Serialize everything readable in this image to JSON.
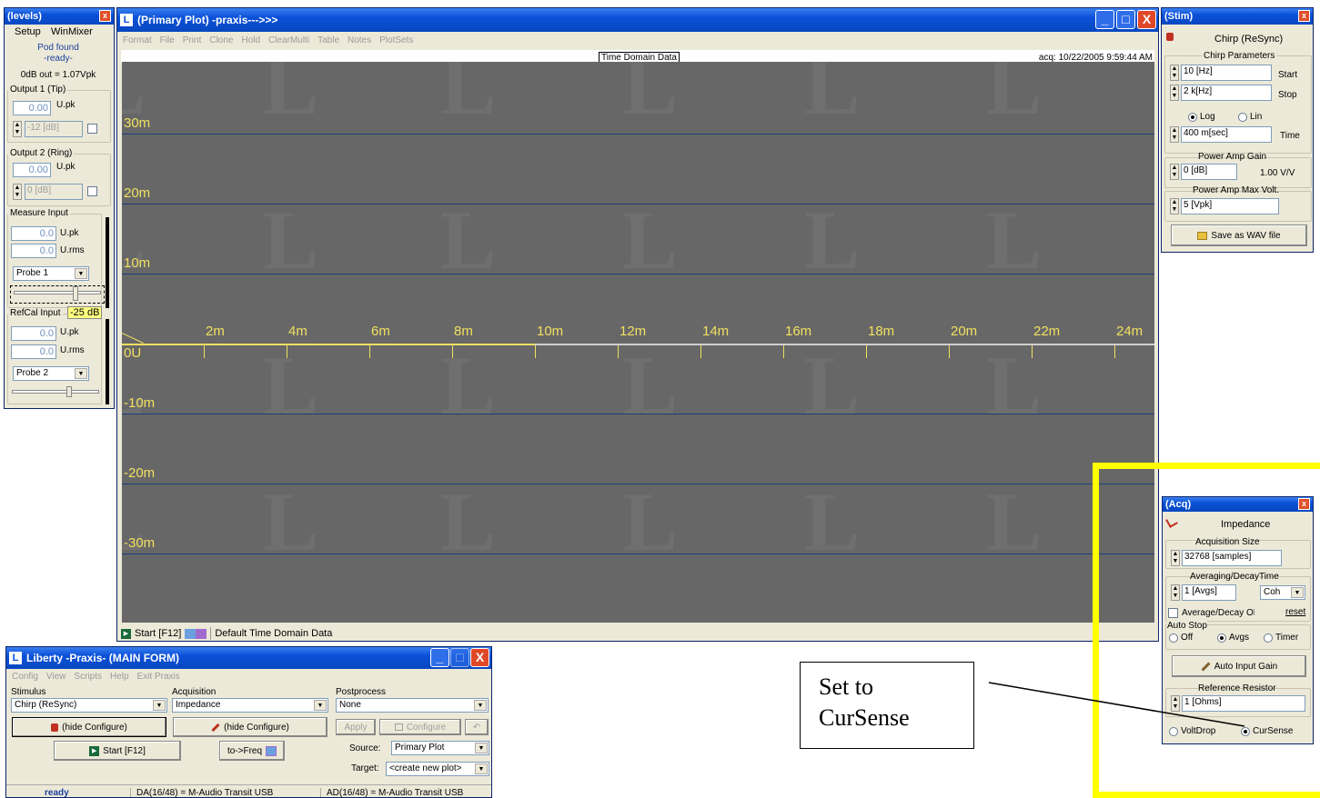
{
  "levels": {
    "title": "(levels)",
    "menu": [
      "Setup",
      "WinMixer"
    ],
    "status1": "Pod found",
    "status2": "-ready-",
    "odb": "0dB out = 1.07Vpk",
    "output1": {
      "label": "Output 1 (Tip)",
      "value": "0.00",
      "unit": "U.pk",
      "gain": "-12 [dB]"
    },
    "output2": {
      "label": "Output 2 (Ring)",
      "value": "0.00",
      "unit": "U.pk",
      "gain": "0 [dB]"
    },
    "measure": {
      "label": "Measure Input",
      "pk": "0.0",
      "pk_unit": "U.pk",
      "rms": "0.0",
      "rms_unit": "U.rms",
      "probe": "Probe 1"
    },
    "refcal": {
      "label": "RefCal Input",
      "tag": "-25 dB",
      "pk": "0.0",
      "pk_unit": "U.pk",
      "rms": "0.0",
      "rms_unit": "U.rms",
      "probe": "Probe 2"
    }
  },
  "plot": {
    "title": "(Primary Plot) -praxis--->>>",
    "menu": [
      "Format",
      "File",
      "Print",
      "Clone",
      "Hold",
      "ClearMulti",
      "Table",
      "Notes",
      "PlotSets"
    ],
    "heading": "Time Domain Data",
    "acq": "acq: 10/22/2005 9:59:44 AM",
    "y_labels": [
      "30m",
      "20m",
      "10m",
      "0U",
      "-10m",
      "-20m",
      "-30m"
    ],
    "x_labels": [
      "2m",
      "4m",
      "6m",
      "8m",
      "10m",
      "12m",
      "14m",
      "16m",
      "18m",
      "20m",
      "22m",
      "24m"
    ],
    "watermark": "L",
    "status_start": "Start [F12]",
    "status_text": "Default Time Domain Data"
  },
  "stim": {
    "title": "(Stim)",
    "mode": "Chirp (ReSync)",
    "chirp_params": "Chirp Parameters",
    "start_value": "10 [Hz]",
    "start_label": "Start",
    "stop_value": "2 k[Hz]",
    "stop_label": "Stop",
    "log": "Log",
    "lin": "Lin",
    "time_value": "400 m[sec]",
    "time_label": "Time",
    "pa_gain_label": "Power Amp Gain",
    "pa_gain_value": "0 [dB]",
    "pa_gain_vv": "1.00 V/V",
    "pa_max_label": "Power Amp Max Volt.",
    "pa_max_value": "5 [Vpk]",
    "save_wav": "Save as WAV file"
  },
  "acq": {
    "title": "(Acq)",
    "mode": "Impedance",
    "size_label": "Acquisition Size",
    "size_value": "32768 [samples]",
    "avg_label": "Averaging/DecayTime",
    "avg_value": "1 [Avgs]",
    "avg_type": "Coh",
    "avg_decay": "Average/Decay ON",
    "reset": "reset",
    "autostop": "Auto Stop",
    "off": "Off",
    "avgs": "Avgs",
    "timer": "Timer",
    "auto_gain": "Auto Input Gain",
    "ref_label": "Reference Resistor",
    "ref_value": "1 [Ohms]",
    "voltdrop": "VoltDrop",
    "cursense": "CurSense"
  },
  "main": {
    "title": "Liberty -Praxis- (MAIN FORM)",
    "menu": [
      "Config",
      "View",
      "Scripts",
      "Help",
      "Exit Praxis"
    ],
    "stimulus_label": "Stimulus",
    "stimulus_value": "Chirp (ReSync)",
    "acquisition_label": "Acquisition",
    "acquisition_value": "Impedance",
    "postprocess_label": "Postprocess",
    "postprocess_value": "None",
    "hide_configure": "(hide Configure)",
    "apply": "Apply",
    "configure": "Configure",
    "start": "Start [F12]",
    "to_freq": "to->Freq",
    "source_label": "Source:",
    "source_value": "Primary Plot",
    "target_label": "Target:",
    "target_value": "<create new plot>",
    "status": "ready",
    "da": "DA(16/48) = M-Audio Transit USB",
    "ad": "AD(16/48) = M-Audio Transit USB"
  },
  "callout": {
    "line1": "Set to",
    "line2": "CurSense"
  },
  "colors": {
    "highlight": "#ffff00",
    "titlebar": "#0a50d8",
    "plot_bg": "#676767",
    "grid": "#1c3f7a",
    "trace": "#f0e060"
  }
}
